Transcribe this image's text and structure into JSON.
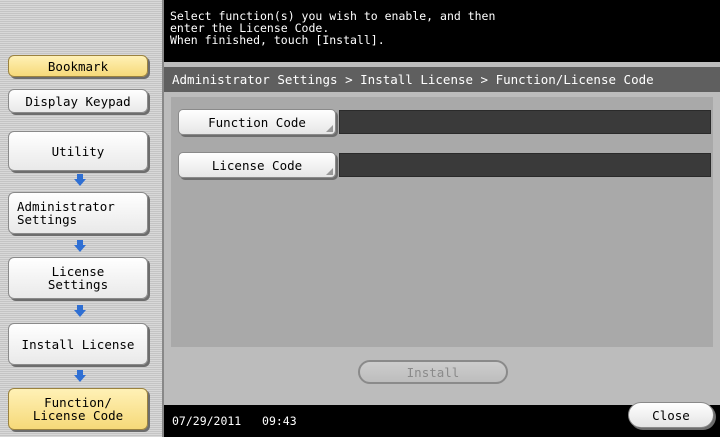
{
  "sidebar": {
    "bookmark": "Bookmark",
    "display_keypad": "Display Keypad",
    "utility": "Utility",
    "administrator_settings": "Administrator\nSettings",
    "license_settings": "License\nSettings",
    "install_license": "Install License",
    "function_license_code": "Function/\nLicense Code"
  },
  "message": "Select function(s) you wish to enable, and then\nenter the License Code.\nWhen finished, touch [Install].",
  "breadcrumb": "Administrator Settings > Install License > Function/License Code",
  "fields": {
    "function_code_label": "Function Code",
    "function_code_value": "",
    "license_code_label": "License Code",
    "license_code_value": ""
  },
  "install_label": "Install",
  "status": {
    "date": "07/29/2011",
    "time": "09:43"
  },
  "close_label": "Close",
  "colors": {
    "highlight": "#f6d979",
    "arrow": "#2f6fd3"
  }
}
